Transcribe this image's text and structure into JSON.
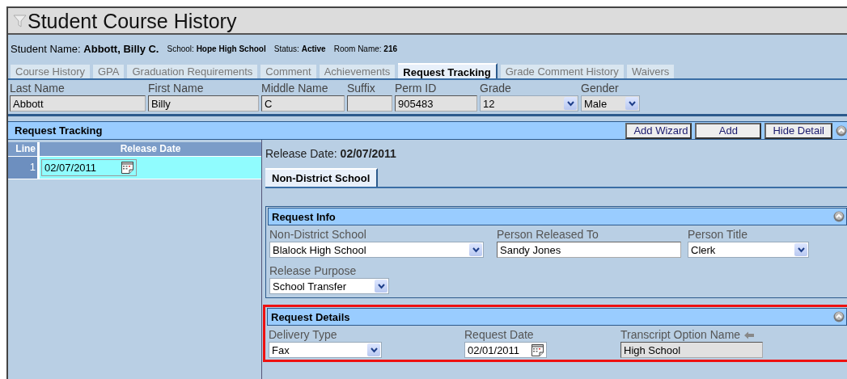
{
  "window": {
    "title": "Student Course History"
  },
  "student_info": [
    {
      "label": "Student Name:",
      "value": "Abbott, Billy C.",
      "kind": "large"
    },
    {
      "label": "School:",
      "value": "Hope High School",
      "kind": "small"
    },
    {
      "label": "Status:",
      "value": "Active",
      "kind": "small"
    },
    {
      "label": "Room Name:",
      "value": "216",
      "kind": "small"
    }
  ],
  "tabs": [
    {
      "label": "Course History",
      "selected": false
    },
    {
      "label": "GPA",
      "selected": false
    },
    {
      "label": "Graduation Requirements",
      "selected": false
    },
    {
      "label": "Comment",
      "selected": false
    },
    {
      "label": "Achievements",
      "selected": false
    },
    {
      "label": "Request Tracking",
      "selected": true
    },
    {
      "label": "Grade Comment History",
      "selected": false
    },
    {
      "label": "Waivers",
      "selected": false
    }
  ],
  "demographics": [
    {
      "label": "Last Name",
      "value": "Abbott",
      "kind": "readonly"
    },
    {
      "label": "First Name",
      "value": "Billy",
      "kind": "readonly"
    },
    {
      "label": "Middle Name",
      "value": "C",
      "kind": "readonly"
    },
    {
      "label": "Suffix",
      "kind": "readonly"
    },
    {
      "label": "Perm ID",
      "value": "905483",
      "kind": "readonly"
    },
    {
      "label": "Grade",
      "value": "12",
      "kind": "select"
    },
    {
      "label": "Gender",
      "value": "Male",
      "kind": "select"
    }
  ],
  "request_tracking": {
    "title": "Request Tracking",
    "buttons": [
      "Add Wizard",
      "Add",
      "Hide Detail"
    ],
    "grid": {
      "columns": [
        "Line",
        "Release Date"
      ],
      "rows": [
        {
          "line": "1",
          "release_date": "02/07/2011",
          "selected": true
        }
      ]
    }
  },
  "detail": {
    "label": "Release Date:",
    "value": "02/07/2011",
    "tabs": [
      {
        "label": "Non-District School",
        "selected": true
      }
    ],
    "sections": [
      {
        "title": "Request Info",
        "highlighted": false,
        "fields": [
          {
            "label": "Non-District School",
            "value": "Blalock High School",
            "kind": "select"
          },
          {
            "label": "Person Released To",
            "value": "Sandy Jones",
            "kind": "text"
          },
          {
            "label": "Person Title",
            "value": "Clerk",
            "kind": "select"
          },
          {
            "label": "Release Purpose",
            "value": "School Transfer",
            "kind": "select"
          }
        ]
      },
      {
        "title": "Request Details",
        "highlighted": true,
        "fields": [
          {
            "label": "Delivery Type",
            "value": "Fax",
            "kind": "select"
          },
          {
            "label": "Request Date",
            "value": "02/01/2011",
            "kind": "date"
          },
          {
            "label": "Transcript Option Name",
            "value": "High School",
            "kind": "readonly",
            "linked": true
          }
        ]
      }
    ]
  }
}
